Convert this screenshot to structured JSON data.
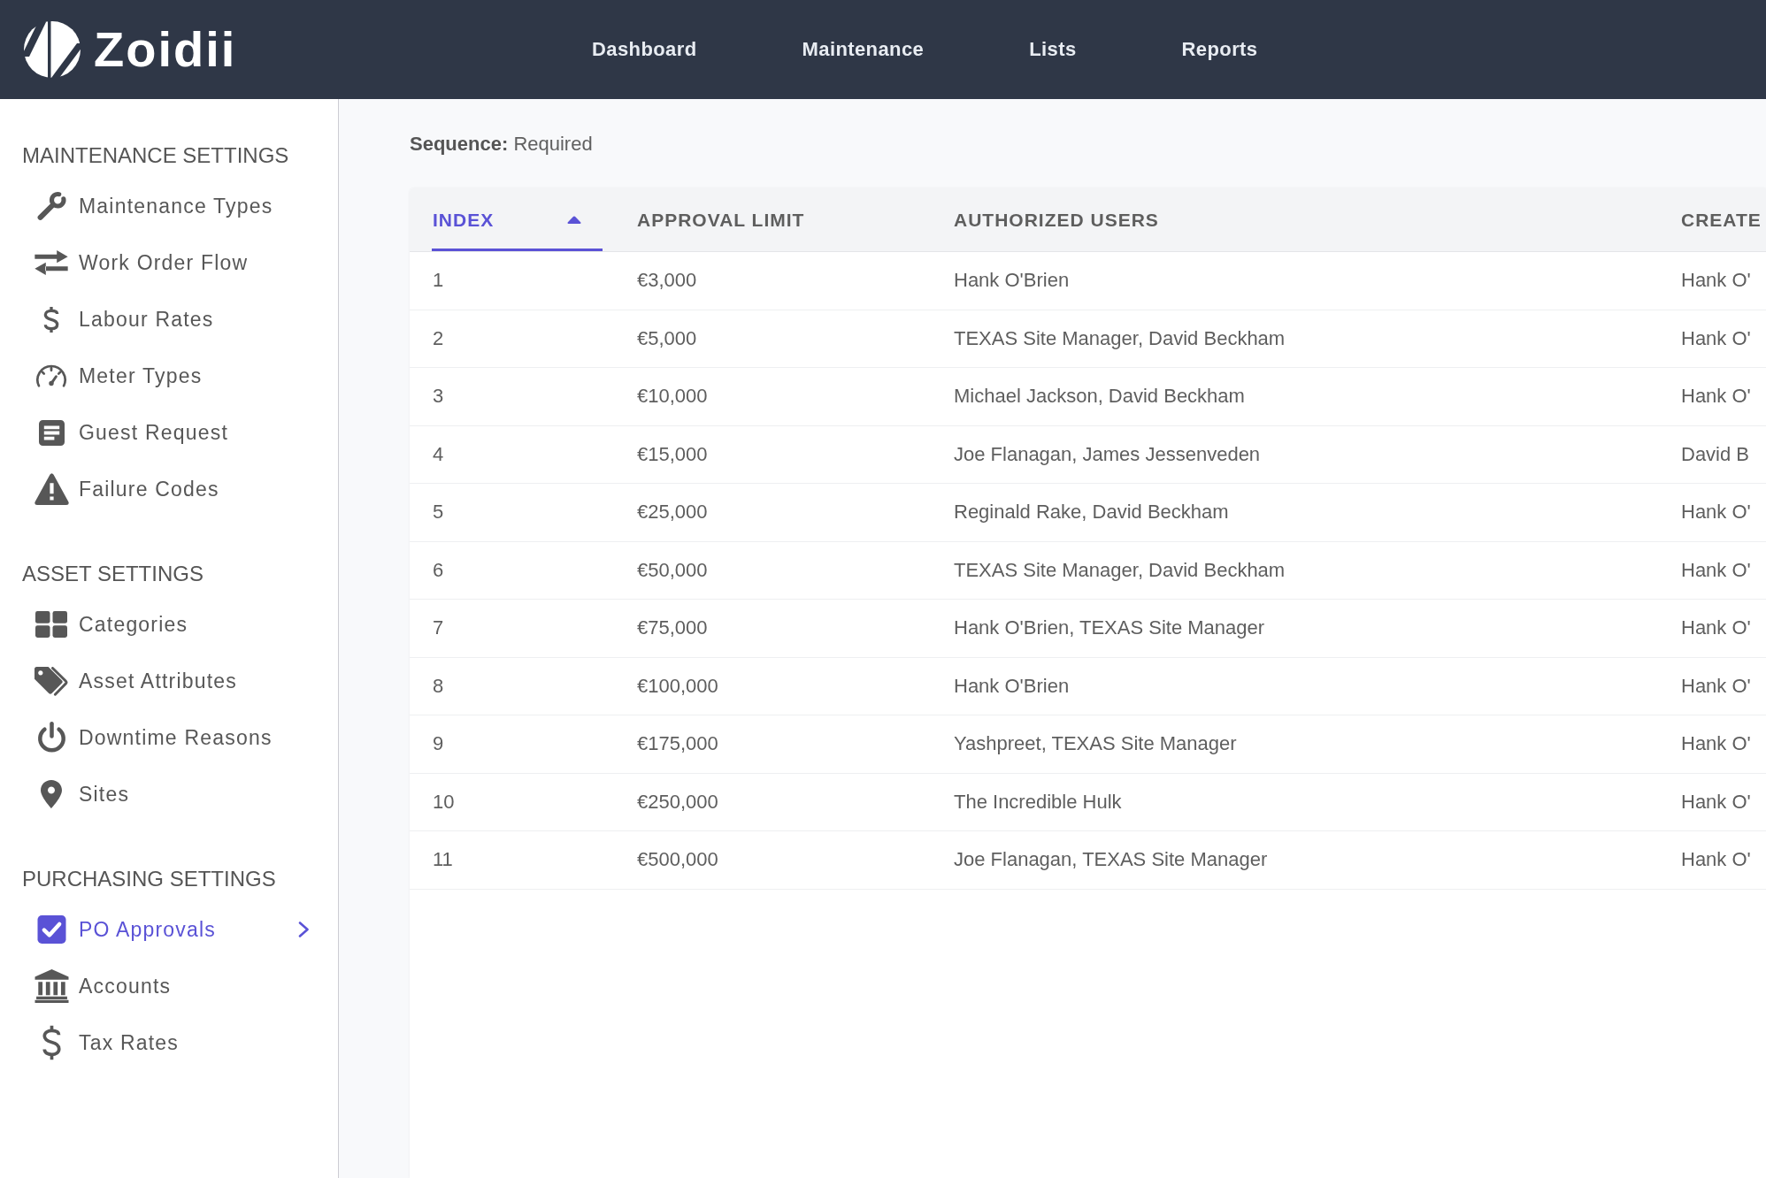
{
  "header": {
    "logo": "Zoidii",
    "nav": [
      "Dashboard",
      "Maintenance",
      "Lists",
      "Reports"
    ]
  },
  "sidebar": {
    "sections": [
      {
        "title": "MAINTENANCE SETTINGS",
        "items": [
          {
            "label": "Maintenance Types",
            "selected": false
          },
          {
            "label": "Work Order Flow",
            "selected": false
          },
          {
            "label": "Labour Rates",
            "selected": false
          },
          {
            "label": "Meter Types",
            "selected": false
          },
          {
            "label": "Guest Request",
            "selected": false
          },
          {
            "label": "Failure Codes",
            "selected": false
          }
        ]
      },
      {
        "title": "ASSET SETTINGS",
        "items": [
          {
            "label": "Categories",
            "selected": false
          },
          {
            "label": "Asset Attributes",
            "selected": false
          },
          {
            "label": "Downtime Reasons",
            "selected": false
          },
          {
            "label": "Sites",
            "selected": false
          }
        ]
      },
      {
        "title": "PURCHASING SETTINGS",
        "items": [
          {
            "label": "PO Approvals",
            "selected": true
          },
          {
            "label": "Accounts",
            "selected": false
          },
          {
            "label": "Tax Rates",
            "selected": false
          }
        ]
      }
    ]
  },
  "content": {
    "sequence": "**Sequence:** Required",
    "table": {
      "columns": [
        {
          "label": "INDEX",
          "sorted": true
        },
        {
          "label": "APPROVAL LIMIT",
          "sorted": false
        },
        {
          "label": "AUTHORIZED USERS",
          "sorted": false
        },
        {
          "label": "CREATE",
          "sorted": false
        }
      ],
      "rows": [
        [
          "1",
          "€3,000",
          "Hank O'Brien",
          "Hank O'"
        ],
        [
          "2",
          "€5,000",
          "TEXAS Site Manager, David Beckham",
          "Hank O'"
        ],
        [
          "3",
          "€10,000",
          "Michael Jackson, David Beckham",
          "Hank O'"
        ],
        [
          "4",
          "€15,000",
          "Joe Flanagan, James Jessenveden",
          "David B"
        ],
        [
          "5",
          "€25,000",
          "Reginald Rake, David Beckham",
          "Hank O'"
        ],
        [
          "6",
          "€50,000",
          "TEXAS Site Manager, David Beckham",
          "Hank O'"
        ],
        [
          "7",
          "€75,000",
          "Hank O'Brien, TEXAS Site Manager",
          "Hank O'"
        ],
        [
          "8",
          "€100,000",
          "Hank O'Brien",
          "Hank O'"
        ],
        [
          "9",
          "€175,000",
          "Yashpreet, TEXAS Site Manager",
          "Hank O'"
        ],
        [
          "10",
          "€250,000",
          "The Incredible Hulk",
          "Hank O'"
        ],
        [
          "11",
          "€500,000",
          "Joe Flanagan, TEXAS Site Manager",
          "Hank O'"
        ]
      ]
    }
  }
}
